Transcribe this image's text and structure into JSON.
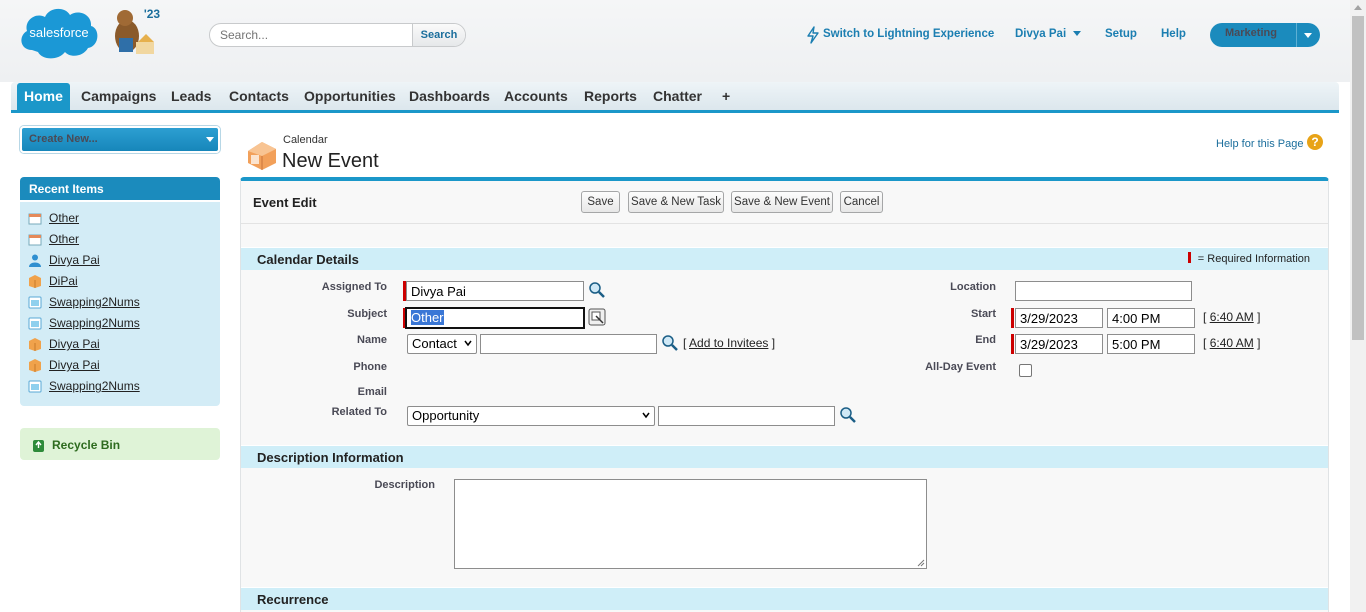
{
  "header": {
    "logo_text": "salesforce",
    "release_badge": "'23",
    "search": {
      "placeholder": "Search...",
      "button_label": "Search"
    },
    "lightning_link": "Switch to Lightning Experience",
    "user_menu": "Divya Pai",
    "setup": "Setup",
    "help": "Help",
    "app_switcher": "Marketing"
  },
  "tabs": [
    "Home",
    "Campaigns",
    "Leads",
    "Contacts",
    "Opportunities",
    "Dashboards",
    "Accounts",
    "Reports",
    "Chatter",
    "+"
  ],
  "active_tab": "Home",
  "sidebar": {
    "create_new": "Create New...",
    "recent_title": "Recent Items",
    "recent_items": [
      {
        "label": "Other",
        "icon": "event-icon"
      },
      {
        "label": "Other",
        "icon": "event-icon"
      },
      {
        "label": "Divya Pai",
        "icon": "contact-icon"
      },
      {
        "label": "DiPai",
        "icon": "account-icon"
      },
      {
        "label": "Swapping2Nums",
        "icon": "case-icon"
      },
      {
        "label": "Swapping2Nums",
        "icon": "case-icon"
      },
      {
        "label": "Divya Pai",
        "icon": "account-icon"
      },
      {
        "label": "Divya Pai",
        "icon": "account-icon"
      },
      {
        "label": "Swapping2Nums",
        "icon": "case-icon"
      }
    ],
    "recycle_bin": "Recycle Bin"
  },
  "page": {
    "breadcrumb": "Calendar",
    "title": "New Event",
    "help_link": "Help for this Page"
  },
  "form": {
    "title": "Event Edit",
    "buttons": {
      "save": "Save",
      "save_new_task": "Save & New Task",
      "save_new_event": "Save & New Event",
      "cancel": "Cancel"
    },
    "sections": {
      "calendar": "Calendar Details",
      "description": "Description Information",
      "recurrence": "Recurrence"
    },
    "required_legend": "= Required Information",
    "labels": {
      "assigned_to": "Assigned To",
      "subject": "Subject",
      "name": "Name",
      "phone": "Phone",
      "email": "Email",
      "related_to": "Related To",
      "location": "Location",
      "start": "Start",
      "end": "End",
      "all_day": "All-Day Event",
      "description": "Description"
    },
    "values": {
      "assigned_to": "Divya Pai",
      "subject": "Other",
      "name_type": "Contact",
      "name": "",
      "related_type": "Opportunity",
      "related": "",
      "location": "",
      "start_date": "3/29/2023",
      "start_time": "4:00 PM",
      "end_date": "3/29/2023",
      "end_time": "5:00 PM",
      "now_time": "6:40 AM",
      "all_day": false,
      "description": ""
    },
    "add_to_invitees": "Add to Invitees",
    "bracket_open": "[",
    "bracket_close": "]"
  },
  "colors": {
    "brand_blue": "#1b97c9",
    "required_red": "#cc0000",
    "section_bg": "#cfeef8"
  }
}
